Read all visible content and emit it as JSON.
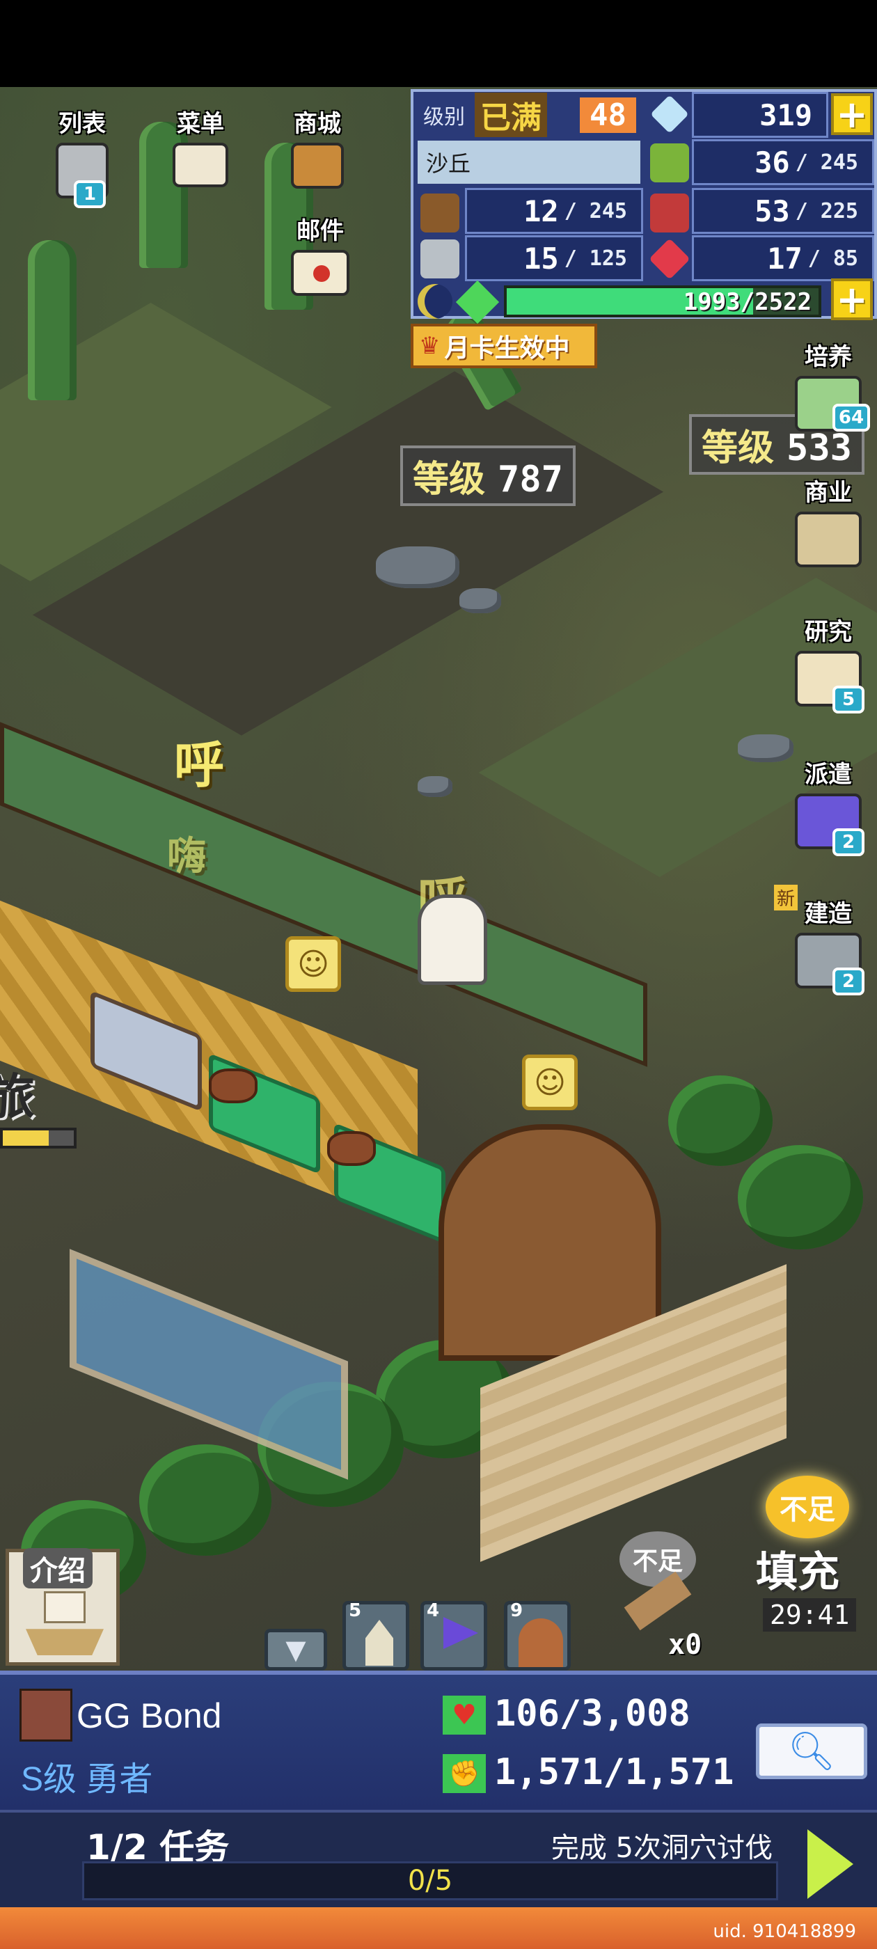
{
  "top_menu": {
    "list": {
      "label": "列表",
      "badge": "1"
    },
    "menu": {
      "label": "菜单"
    },
    "shop": {
      "label": "商城"
    },
    "mail": {
      "label": "邮件"
    }
  },
  "resources": {
    "level_label": "级别",
    "level_status": "已满",
    "level_value": "48",
    "gems": "319",
    "area_name": "沙丘",
    "grass": {
      "value": "36",
      "max": "/ 245"
    },
    "wood": {
      "value": "12",
      "max": "/ 245"
    },
    "food": {
      "value": "53",
      "max": "/ 225"
    },
    "stone": {
      "value": "15",
      "max": "/ 125"
    },
    "ruby": {
      "value": "17",
      "max": "/ 85"
    },
    "energy": "1993/2522",
    "energy_fraction": 0.79
  },
  "monthly_card": "月卡生效中",
  "level_tags": [
    {
      "label": "等级",
      "value": "787"
    },
    {
      "label": "等级",
      "value": "533"
    }
  ],
  "side_menu": {
    "train": {
      "label": "培养",
      "badge": "64"
    },
    "business": {
      "label": "商业"
    },
    "research": {
      "label": "研究",
      "badge": "5"
    },
    "dispatch": {
      "label": "派遣",
      "badge": "2"
    },
    "build": {
      "label": "建造",
      "badge": "2",
      "new_tag": "新"
    }
  },
  "floaters": [
    "呼",
    "嗨",
    "呼"
  ],
  "building_label": "旅",
  "intro_button": "介绍",
  "shortage": {
    "stamp": "不足",
    "count": "x0"
  },
  "refill": {
    "stamp": "不足",
    "label": "填充",
    "timer": "29:41"
  },
  "hud_slots": [
    {
      "num": "5",
      "icon": "tower-icon"
    },
    {
      "num": "4",
      "icon": "flag-icon"
    },
    {
      "num": "9",
      "icon": "cave-icon"
    }
  ],
  "player": {
    "name": "GG Bond",
    "rank": "S级 勇者",
    "hp": "106/3,008",
    "stamina": "1,571/1,571"
  },
  "quest": {
    "progress_label": "1/2 任务",
    "description": "完成 5次洞穴讨伐",
    "count": "0/5"
  },
  "uid": "uid. 910418899",
  "colors": {
    "panel": "#2a3a78",
    "accent_yellow": "#f7d217",
    "grass": "#4a5a3a"
  }
}
